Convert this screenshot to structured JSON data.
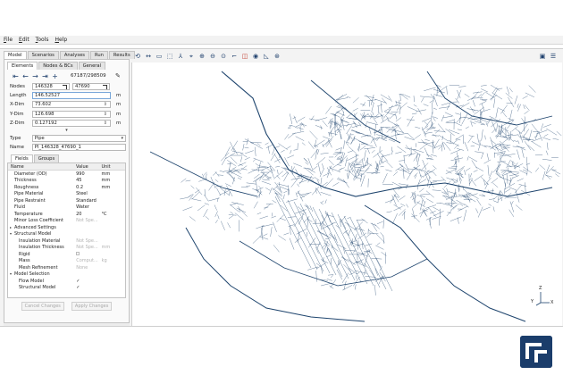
{
  "menu": [
    "File",
    "Edit",
    "Tools",
    "Help"
  ],
  "main_tabs": [
    "Model",
    "Scenarios",
    "Analyses",
    "Run",
    "Results"
  ],
  "sub_tabs": [
    "Elements",
    "Nodes & BCs",
    "General"
  ],
  "element_toolbar": {
    "icons": [
      "first-icon",
      "prev-icon",
      "next-icon",
      "last-icon",
      "add-icon"
    ],
    "id_text": "67187/298509"
  },
  "fields": {
    "nodes_label": "Nodes",
    "node_a": "146328",
    "node_b": "47690",
    "length_label": "Length",
    "length": "146.52527",
    "length_unit": "m",
    "xdim_label": "X-Dim",
    "xdim": "73.602",
    "xdim_unit": "m",
    "ydim_label": "Y-Dim",
    "ydim": "126.698",
    "ydim_unit": "m",
    "zdim_label": "Z-Dim",
    "zdim": "0.127192",
    "zdim_unit": "m",
    "type_label": "Type",
    "type_value": "Pipe",
    "name_label": "Name",
    "name_value": "PI_146328_47690_1"
  },
  "props_tabs": [
    "Fields",
    "Groups"
  ],
  "props_header": [
    "Name",
    "Value",
    "Unit"
  ],
  "props_rows": [
    {
      "name": "Diameter (OD)",
      "value": "990",
      "unit": "mm",
      "indent": 1,
      "muted": false
    },
    {
      "name": "Thickness",
      "value": "45",
      "unit": "mm",
      "indent": 1,
      "muted": false
    },
    {
      "name": "Roughness",
      "value": "0.2",
      "unit": "mm",
      "indent": 1,
      "muted": false
    },
    {
      "name": "Pipe Material",
      "value": "Steel",
      "unit": "",
      "indent": 1,
      "muted": false
    },
    {
      "name": "Pipe Restraint",
      "value": "Standard",
      "unit": "",
      "indent": 1,
      "muted": false
    },
    {
      "name": "Fluid",
      "value": "Water",
      "unit": "",
      "indent": 1,
      "muted": false
    },
    {
      "name": "Temperature",
      "value": "20",
      "unit": "°C",
      "indent": 1,
      "muted": false
    },
    {
      "name": "Minor Loss Coefficient",
      "value": "Not Spe...",
      "unit": "",
      "indent": 1,
      "muted": true
    },
    {
      "name": "Advanced Settings",
      "value": "",
      "unit": "",
      "indent": 0,
      "caret": "▸",
      "muted": false
    },
    {
      "name": "Structural Model",
      "value": "",
      "unit": "",
      "indent": 0,
      "caret": "▾",
      "muted": false
    },
    {
      "name": "Insulation Material",
      "value": "Not Spe...",
      "unit": "",
      "indent": 2,
      "muted": true
    },
    {
      "name": "Insulation Thickness",
      "value": "Not Spe...",
      "unit": "mm",
      "indent": 2,
      "muted": true
    },
    {
      "name": "Rigid",
      "value": "",
      "unit": "",
      "indent": 2,
      "box": true,
      "muted": false
    },
    {
      "name": "Mass",
      "value": "Comput...",
      "unit": "kg",
      "indent": 2,
      "muted": true
    },
    {
      "name": "Mesh Refinement",
      "value": "None",
      "unit": "",
      "indent": 2,
      "muted": true
    },
    {
      "name": "Model Selection",
      "value": "",
      "unit": "",
      "indent": 0,
      "caret": "▾",
      "muted": false
    },
    {
      "name": "Flow Model",
      "value": "✓",
      "unit": "",
      "indent": 2,
      "muted": false
    },
    {
      "name": "Structural Model",
      "value": "✓",
      "unit": "",
      "indent": 2,
      "muted": false
    }
  ],
  "buttons": {
    "cancel": "Cancel Changes",
    "apply": "Apply Changes"
  },
  "viewer_toolbar_icons": [
    "orbit-icon",
    "pan-icon",
    "select-box-icon",
    "select-region-icon",
    "axes-icon",
    "center-icon",
    "zoom-in-icon",
    "zoom-out-icon",
    "zoom-fit-icon",
    "measure-icon",
    "view-3d-icon",
    "visibility-icon",
    "slope-icon",
    "globe-icon"
  ],
  "viewer_right_icons": [
    "screenshot-icon",
    "settings-icon"
  ],
  "axis_labels": {
    "z": "Z",
    "y": "Y",
    "x": "X"
  },
  "colors": {
    "network": "#1f456e",
    "brand": "#1b3d6b"
  }
}
